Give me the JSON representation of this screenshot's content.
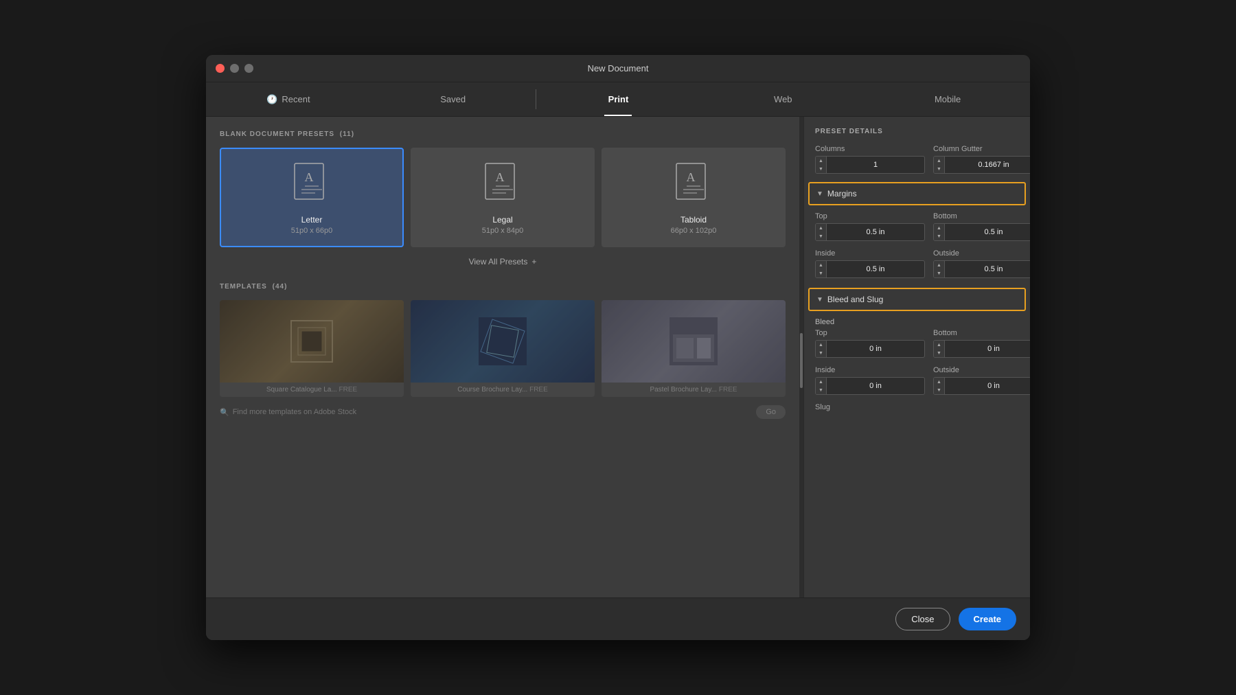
{
  "window": {
    "title": "New Document"
  },
  "tabs": [
    {
      "id": "recent",
      "label": "Recent",
      "icon": "clock",
      "active": false
    },
    {
      "id": "saved",
      "label": "Saved",
      "active": false
    },
    {
      "id": "print",
      "label": "Print",
      "active": true
    },
    {
      "id": "web",
      "label": "Web",
      "active": false
    },
    {
      "id": "mobile",
      "label": "Mobile",
      "active": false
    }
  ],
  "presets_section": {
    "label": "BLANK DOCUMENT PRESETS",
    "count": "(11)",
    "presets": [
      {
        "id": "letter",
        "name": "Letter",
        "size": "51p0 x 66p0",
        "selected": true
      },
      {
        "id": "legal",
        "name": "Legal",
        "size": "51p0 x 84p0",
        "selected": false
      },
      {
        "id": "tabloid",
        "name": "Tabloid",
        "size": "66p0 x 102p0",
        "selected": false
      }
    ],
    "view_all_label": "View All Presets"
  },
  "templates_section": {
    "label": "TEMPLATES",
    "count": "(44)",
    "templates": [
      {
        "id": "tpl1",
        "name": "Square Catalogue La...",
        "badge": "FREE"
      },
      {
        "id": "tpl2",
        "name": "Course Brochure Lay...",
        "badge": "FREE"
      },
      {
        "id": "tpl3",
        "name": "Pastel Brochure Lay...",
        "badge": "FREE"
      }
    ],
    "search_label": "Find more templates on Adobe Stock",
    "go_label": "Go"
  },
  "right_panel": {
    "title": "PRESET DETAILS",
    "columns_label": "Columns",
    "columns_value": "1",
    "column_gutter_label": "Column Gutter",
    "column_gutter_value": "0.1667 in",
    "margins": {
      "section_label": "Margins",
      "top_label": "Top",
      "top_value": "0.5 in",
      "bottom_label": "Bottom",
      "bottom_value": "0.5 in",
      "inside_label": "Inside",
      "inside_value": "0.5 in",
      "outside_label": "Outside",
      "outside_value": "0.5 in"
    },
    "bleed_slug": {
      "section_label": "Bleed and Slug",
      "bleed_label": "Bleed",
      "top_label": "Top",
      "top_value": "0 in",
      "bottom_label": "Bottom",
      "bottom_value": "0 in",
      "inside_label": "Inside",
      "inside_value": "0 in",
      "outside_label": "Outside",
      "outside_value": "0 in",
      "slug_label": "Slug"
    }
  },
  "buttons": {
    "close_label": "Close",
    "create_label": "Create"
  }
}
